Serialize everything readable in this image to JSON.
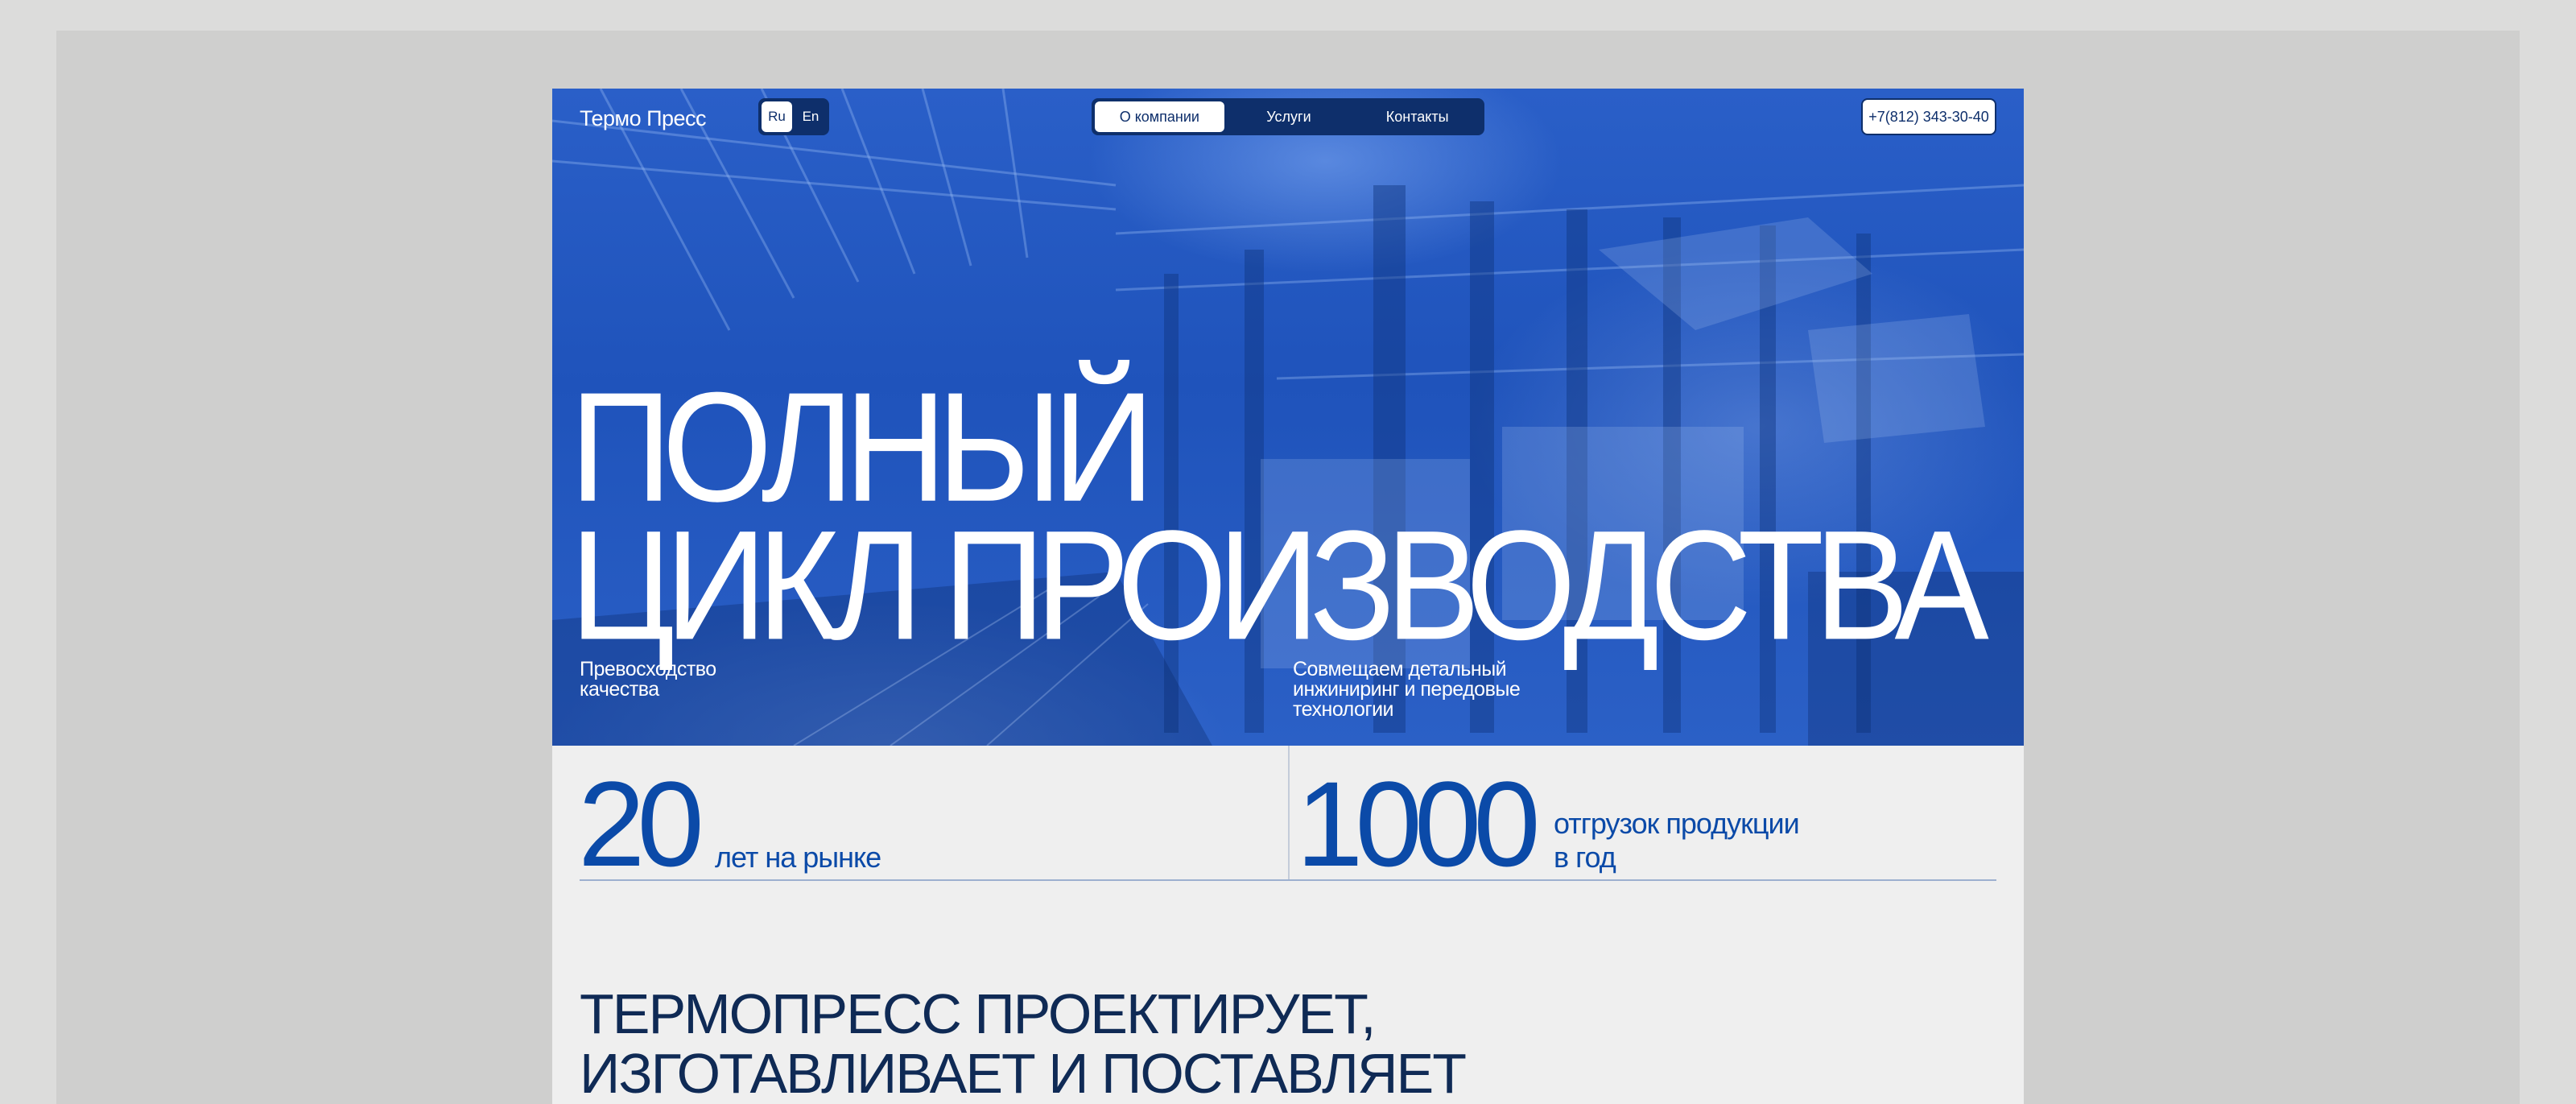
{
  "header": {
    "logo": "Термо Пресс",
    "languages": [
      {
        "label": "Ru",
        "active": true
      },
      {
        "label": "En",
        "active": false
      }
    ],
    "nav": [
      {
        "label": "О компании",
        "active": true
      },
      {
        "label": "Услуги",
        "active": false
      },
      {
        "label": "Контакты",
        "active": false
      }
    ],
    "phone": "+7(812) 343-30-40"
  },
  "hero": {
    "headline_line1": "ПОЛНЫЙ",
    "headline_line2": "ЦИКЛ ПРОИЗВОДСТВА",
    "sub_left": "Превосходство качества",
    "sub_right": "Совмещаем детальный инжиниринг и передовые технологии"
  },
  "stats": [
    {
      "number": "20",
      "label": "лет на рынке"
    },
    {
      "number": "1000",
      "label": "отгрузок продукции в год"
    }
  ],
  "about": {
    "line1": "ТЕРМОПРЕСС ПРОЕКТИРУЕТ,",
    "line2": "ИЗГОТАВЛИВАЕТ И ПОСТАВЛЯЕТ"
  },
  "colors": {
    "hero_blue": "#1f53bb",
    "accent": "#0b4aa8",
    "dark_nav": "#0e2f6b",
    "text_dark": "#0f2a55"
  }
}
